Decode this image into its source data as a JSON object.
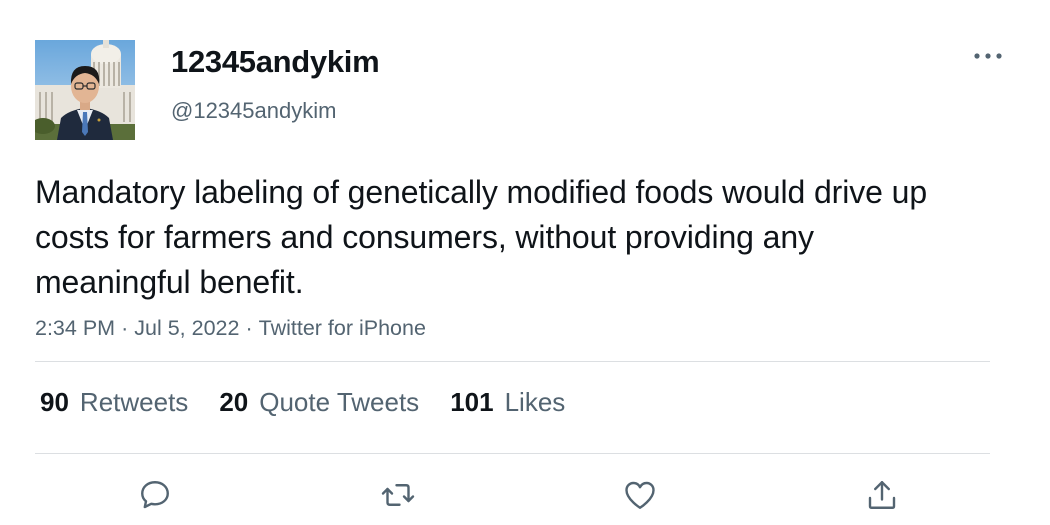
{
  "author": {
    "display_name": "12345andykim",
    "handle": "@12345andykim",
    "avatar_icon": "profile-photo"
  },
  "tweet": {
    "text": "Mandatory labeling of genetically modified foods would drive up costs for farmers and consumers, without providing any meaningful benefit.",
    "time": "2:34 PM",
    "date": "Jul 5, 2022",
    "source": "Twitter for iPhone",
    "separator": "·"
  },
  "stats": {
    "retweets": {
      "count": "90",
      "label": "Retweets"
    },
    "quote_tweets": {
      "count": "20",
      "label": "Quote Tweets"
    },
    "likes": {
      "count": "101",
      "label": "Likes"
    }
  },
  "actions": {
    "reply_icon": "speech-bubble-icon",
    "retweet_icon": "retweet-arrows-icon",
    "like_icon": "heart-icon",
    "share_icon": "upload-share-icon"
  },
  "colors": {
    "text_primary": "#0f1419",
    "text_secondary": "#536471",
    "divider": "#dcdfe2"
  }
}
